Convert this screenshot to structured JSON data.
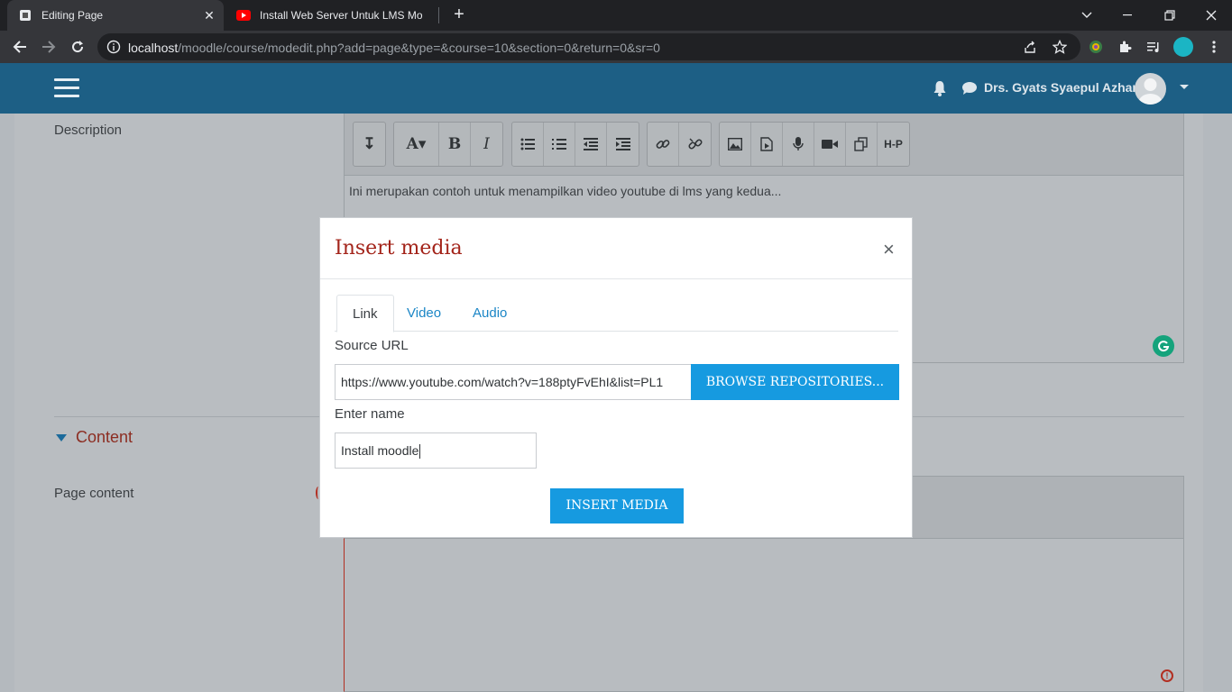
{
  "browser": {
    "tabs": [
      {
        "title": "Editing Page",
        "active": true,
        "icon": "moodle-favicon-icon"
      },
      {
        "title": "Install Web Server Untuk LMS Mo",
        "active": false,
        "icon": "youtube-icon"
      }
    ],
    "url_host": "localhost",
    "url_path": "/moodle/course/modedit.php?add=page&type=&course=10&section=0&return=0&sr=0"
  },
  "moodle_nav": {
    "user_name": "Drs. Gyats Syaepul Azhar"
  },
  "form": {
    "description_label": "Description",
    "description_text": "Ini merupakan contoh untuk menampilkan video youtube di lms yang kedua...",
    "content_section_label": "Content",
    "page_content_label": "Page content"
  },
  "modal": {
    "title": "Insert media",
    "close_label": "×",
    "tabs": [
      "Link",
      "Video",
      "Audio"
    ],
    "source_url_label": "Source URL",
    "source_url_value": "https://www.youtube.com/watch?v=188ptyFvEhI&list=PL1",
    "browse_label": "BROWSE REPOSITORIES...",
    "enter_name_label": "Enter name",
    "name_value": "Install moodle",
    "insert_label": "INSERT MEDIA"
  },
  "colors": {
    "nav_bg": "#1d5f85",
    "modal_title": "#a3241a",
    "primary_button": "#169ae0",
    "tab_link": "#1b86c6"
  }
}
